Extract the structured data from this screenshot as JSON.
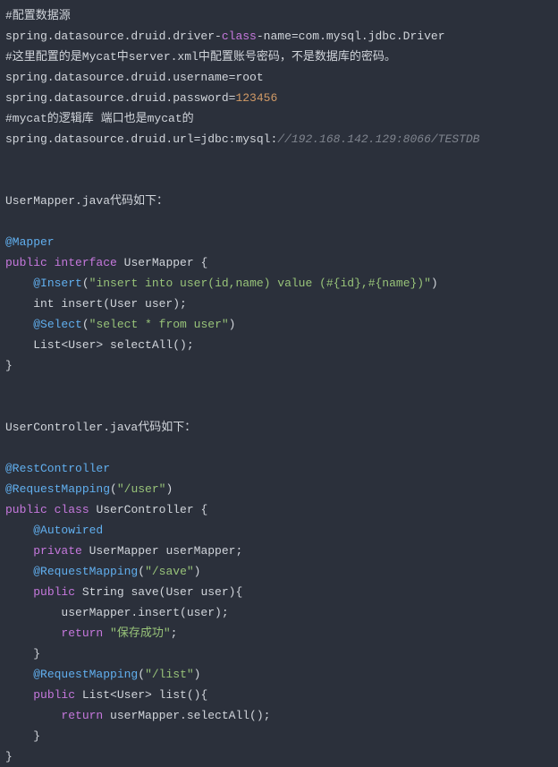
{
  "tokens": [
    {
      "t": "#配置数据源",
      "c": "c-default"
    },
    {
      "t": "\n"
    },
    {
      "t": "spring.datasource.druid.driver-",
      "c": "c-default"
    },
    {
      "t": "class",
      "c": "c-keyword"
    },
    {
      "t": "-name=com.mysql.jdbc.Driver",
      "c": "c-default"
    },
    {
      "t": "\n"
    },
    {
      "t": "#这里配置的是Mycat中server.xml中配置账号密码，不是数据库的密码。",
      "c": "c-default"
    },
    {
      "t": "\n"
    },
    {
      "t": "spring.datasource.druid.username=root",
      "c": "c-default"
    },
    {
      "t": "\n"
    },
    {
      "t": "spring.datasource.druid.password=",
      "c": "c-default"
    },
    {
      "t": "123456",
      "c": "c-number"
    },
    {
      "t": "\n"
    },
    {
      "t": "#mycat的逻辑库 端口也是mycat的",
      "c": "c-default"
    },
    {
      "t": "\n"
    },
    {
      "t": "spring.datasource.druid.url=jdbc:mysql:",
      "c": "c-default"
    },
    {
      "t": "//192.168.142.129:8066/TESTDB",
      "c": "c-comment"
    },
    {
      "t": "\n"
    },
    {
      "t": "\n"
    },
    {
      "t": "\n"
    },
    {
      "t": "UserMapper.java代码如下：",
      "c": "c-default"
    },
    {
      "t": "\n"
    },
    {
      "t": "\n"
    },
    {
      "t": "@Mapper",
      "c": "c-annotation"
    },
    {
      "t": "\n"
    },
    {
      "t": "public",
      "c": "c-keyword"
    },
    {
      "t": " ",
      "c": "c-default"
    },
    {
      "t": "interface",
      "c": "c-keyword"
    },
    {
      "t": " UserMapper {",
      "c": "c-default"
    },
    {
      "t": "\n"
    },
    {
      "t": "    ",
      "c": "c-default"
    },
    {
      "t": "@Insert",
      "c": "c-annotation"
    },
    {
      "t": "(",
      "c": "c-default"
    },
    {
      "t": "\"insert into user(id,name) value (#{id},#{name})\"",
      "c": "c-string"
    },
    {
      "t": ")",
      "c": "c-default"
    },
    {
      "t": "\n"
    },
    {
      "t": "    int insert(User user);",
      "c": "c-default"
    },
    {
      "t": "\n"
    },
    {
      "t": "    ",
      "c": "c-default"
    },
    {
      "t": "@Select",
      "c": "c-annotation"
    },
    {
      "t": "(",
      "c": "c-default"
    },
    {
      "t": "\"select * from user\"",
      "c": "c-string"
    },
    {
      "t": ")",
      "c": "c-default"
    },
    {
      "t": "\n"
    },
    {
      "t": "    List<User> selectAll();",
      "c": "c-default"
    },
    {
      "t": "\n"
    },
    {
      "t": "}",
      "c": "c-default"
    },
    {
      "t": "\n"
    },
    {
      "t": "\n"
    },
    {
      "t": "\n"
    },
    {
      "t": "UserController.java代码如下：",
      "c": "c-default"
    },
    {
      "t": "\n"
    },
    {
      "t": "\n"
    },
    {
      "t": "@RestController",
      "c": "c-annotation"
    },
    {
      "t": "\n"
    },
    {
      "t": "@RequestMapping",
      "c": "c-annotation"
    },
    {
      "t": "(",
      "c": "c-default"
    },
    {
      "t": "\"/user\"",
      "c": "c-string"
    },
    {
      "t": ")",
      "c": "c-default"
    },
    {
      "t": "\n"
    },
    {
      "t": "public",
      "c": "c-keyword"
    },
    {
      "t": " ",
      "c": "c-default"
    },
    {
      "t": "class",
      "c": "c-keyword"
    },
    {
      "t": " UserController {",
      "c": "c-default"
    },
    {
      "t": "\n"
    },
    {
      "t": "    ",
      "c": "c-default"
    },
    {
      "t": "@Autowired",
      "c": "c-annotation"
    },
    {
      "t": "\n"
    },
    {
      "t": "    ",
      "c": "c-default"
    },
    {
      "t": "private",
      "c": "c-keyword"
    },
    {
      "t": " UserMapper userMapper;",
      "c": "c-default"
    },
    {
      "t": "\n"
    },
    {
      "t": "    ",
      "c": "c-default"
    },
    {
      "t": "@RequestMapping",
      "c": "c-annotation"
    },
    {
      "t": "(",
      "c": "c-default"
    },
    {
      "t": "\"/save\"",
      "c": "c-string"
    },
    {
      "t": ")",
      "c": "c-default"
    },
    {
      "t": "\n"
    },
    {
      "t": "    ",
      "c": "c-default"
    },
    {
      "t": "public",
      "c": "c-keyword"
    },
    {
      "t": " String save(User user){",
      "c": "c-default"
    },
    {
      "t": "\n"
    },
    {
      "t": "        userMapper.insert(user);",
      "c": "c-default"
    },
    {
      "t": "\n"
    },
    {
      "t": "        ",
      "c": "c-default"
    },
    {
      "t": "return",
      "c": "c-keyword"
    },
    {
      "t": " ",
      "c": "c-default"
    },
    {
      "t": "\"保存成功\"",
      "c": "c-string"
    },
    {
      "t": ";",
      "c": "c-default"
    },
    {
      "t": "\n"
    },
    {
      "t": "    }",
      "c": "c-default"
    },
    {
      "t": "\n"
    },
    {
      "t": "    ",
      "c": "c-default"
    },
    {
      "t": "@RequestMapping",
      "c": "c-annotation"
    },
    {
      "t": "(",
      "c": "c-default"
    },
    {
      "t": "\"/list\"",
      "c": "c-string"
    },
    {
      "t": ")",
      "c": "c-default"
    },
    {
      "t": "\n"
    },
    {
      "t": "    ",
      "c": "c-default"
    },
    {
      "t": "public",
      "c": "c-keyword"
    },
    {
      "t": " List<User> list(){",
      "c": "c-default"
    },
    {
      "t": "\n"
    },
    {
      "t": "        ",
      "c": "c-default"
    },
    {
      "t": "return",
      "c": "c-keyword"
    },
    {
      "t": " userMapper.selectAll();",
      "c": "c-default"
    },
    {
      "t": "\n"
    },
    {
      "t": "    }",
      "c": "c-default"
    },
    {
      "t": "\n"
    },
    {
      "t": "}",
      "c": "c-default"
    }
  ]
}
